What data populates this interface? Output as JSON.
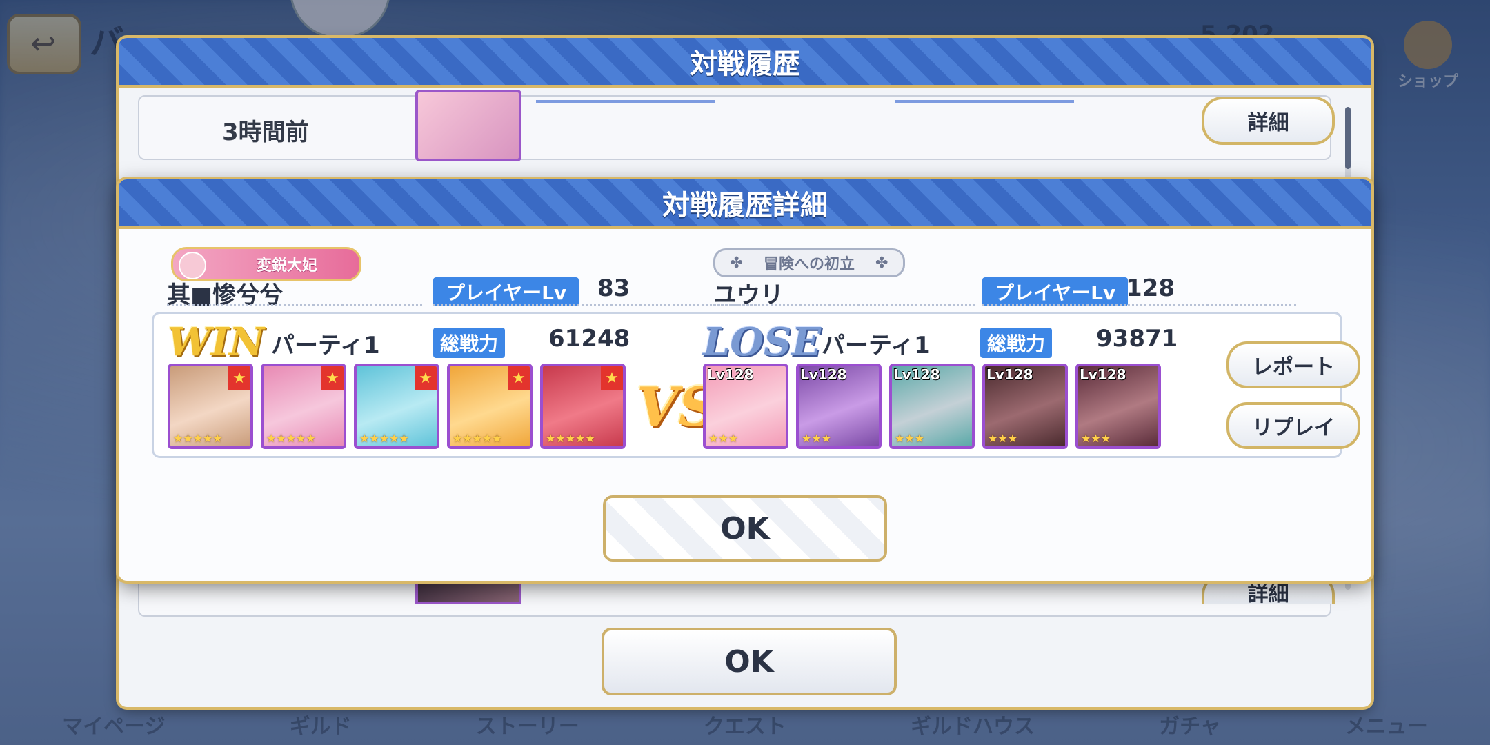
{
  "background": {
    "title": "バ…",
    "currency": "5,202",
    "shop_label": "ショップ",
    "nav": [
      "マイページ",
      "ギルド",
      "ストーリー",
      "クエスト",
      "ギルドハウス",
      "ガチャ",
      "メニュー"
    ]
  },
  "history": {
    "title": "対戦履歴",
    "row_time": "3時間前",
    "detail_label": "詳細",
    "ok_label": "OK"
  },
  "detail": {
    "title": "対戦履歴詳細",
    "left": {
      "emblem": "変鋭大妃",
      "name": "其■惨兮兮",
      "level_label": "プレイヤーLv",
      "level": "83",
      "result": "WIN",
      "party": "パーティ1",
      "power_label": "総戦力",
      "power": "61248",
      "units": [
        {
          "colors": [
            "#c99c7a",
            "#f3d7c4"
          ],
          "stars": "★★★★★"
        },
        {
          "colors": [
            "#e88ab4",
            "#f6c7dc"
          ],
          "stars": "★★★★★"
        },
        {
          "colors": [
            "#5fc3d9",
            "#b8eaf3"
          ],
          "stars": "★★★★★"
        },
        {
          "colors": [
            "#f0a63a",
            "#ffd98f"
          ],
          "stars": "★★★★★"
        },
        {
          "colors": [
            "#c83a4d",
            "#f07a88"
          ],
          "stars": "★★★★★"
        }
      ]
    },
    "right": {
      "emblem": "冒険への初立",
      "name": "ユウリ",
      "level_label": "プレイヤーLv",
      "level": "128",
      "result": "LOSE",
      "party": "パーティ1",
      "power_label": "総戦力",
      "power": "93871",
      "units": [
        {
          "lv": "Lv128",
          "colors": [
            "#f39bb6",
            "#fbd0dc"
          ],
          "stars": "★★★"
        },
        {
          "lv": "Lv128",
          "colors": [
            "#7b4aa6",
            "#c99be6"
          ],
          "stars": "★★★"
        },
        {
          "lv": "Lv128",
          "colors": [
            "#5aa9a8",
            "#c4d0d6"
          ],
          "stars": "★★★"
        },
        {
          "lv": "Lv128",
          "colors": [
            "#4a2a2e",
            "#9c6a70"
          ],
          "stars": "★★★"
        },
        {
          "lv": "Lv128",
          "colors": [
            "#5a2c3a",
            "#b07a82"
          ],
          "stars": "★★★"
        }
      ]
    },
    "vs": "VS",
    "report_label": "レポート",
    "replay_label": "リプレイ",
    "ok_label": "OK"
  }
}
